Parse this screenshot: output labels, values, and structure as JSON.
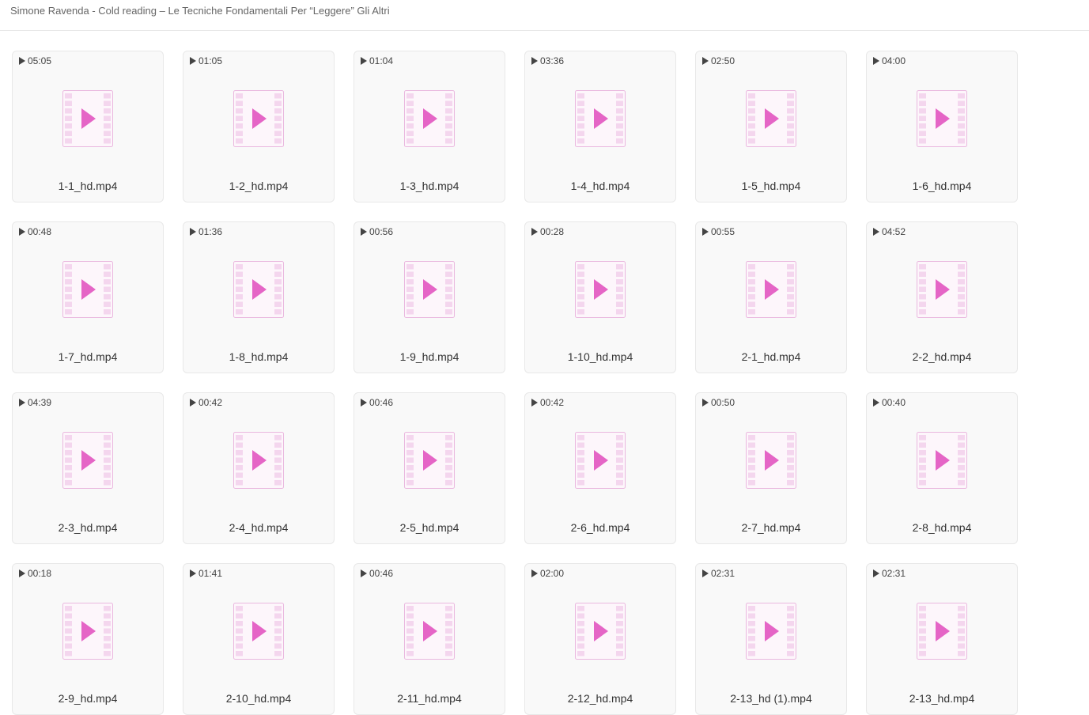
{
  "breadcrumb": {
    "title": "Simone Ravenda - Cold reading – Le Tecniche Fondamentali Per “Leggere” Gli Altri"
  },
  "icons": {
    "duration": "play-icon",
    "thumbnail": "video-file-icon"
  },
  "colors": {
    "accent": "#e565c6",
    "film_strip": "#f4d6ee",
    "tile_bg": "#f9f9f9"
  },
  "files": [
    {
      "duration": "05:05",
      "name": "1-1_hd.mp4"
    },
    {
      "duration": "01:05",
      "name": "1-2_hd.mp4"
    },
    {
      "duration": "01:04",
      "name": "1-3_hd.mp4"
    },
    {
      "duration": "03:36",
      "name": "1-4_hd.mp4"
    },
    {
      "duration": "02:50",
      "name": "1-5_hd.mp4"
    },
    {
      "duration": "04:00",
      "name": "1-6_hd.mp4"
    },
    {
      "duration": "00:48",
      "name": "1-7_hd.mp4"
    },
    {
      "duration": "01:36",
      "name": "1-8_hd.mp4"
    },
    {
      "duration": "00:56",
      "name": "1-9_hd.mp4"
    },
    {
      "duration": "00:28",
      "name": "1-10_hd.mp4"
    },
    {
      "duration": "00:55",
      "name": "2-1_hd.mp4"
    },
    {
      "duration": "04:52",
      "name": "2-2_hd.mp4"
    },
    {
      "duration": "04:39",
      "name": "2-3_hd.mp4"
    },
    {
      "duration": "00:42",
      "name": "2-4_hd.mp4"
    },
    {
      "duration": "00:46",
      "name": "2-5_hd.mp4"
    },
    {
      "duration": "00:42",
      "name": "2-6_hd.mp4"
    },
    {
      "duration": "00:50",
      "name": "2-7_hd.mp4"
    },
    {
      "duration": "00:40",
      "name": "2-8_hd.mp4"
    },
    {
      "duration": "00:18",
      "name": "2-9_hd.mp4"
    },
    {
      "duration": "01:41",
      "name": "2-10_hd.mp4"
    },
    {
      "duration": "00:46",
      "name": "2-11_hd.mp4"
    },
    {
      "duration": "02:00",
      "name": "2-12_hd.mp4"
    },
    {
      "duration": "02:31",
      "name": "2-13_hd (1).mp4"
    },
    {
      "duration": "02:31",
      "name": "2-13_hd.mp4"
    }
  ]
}
